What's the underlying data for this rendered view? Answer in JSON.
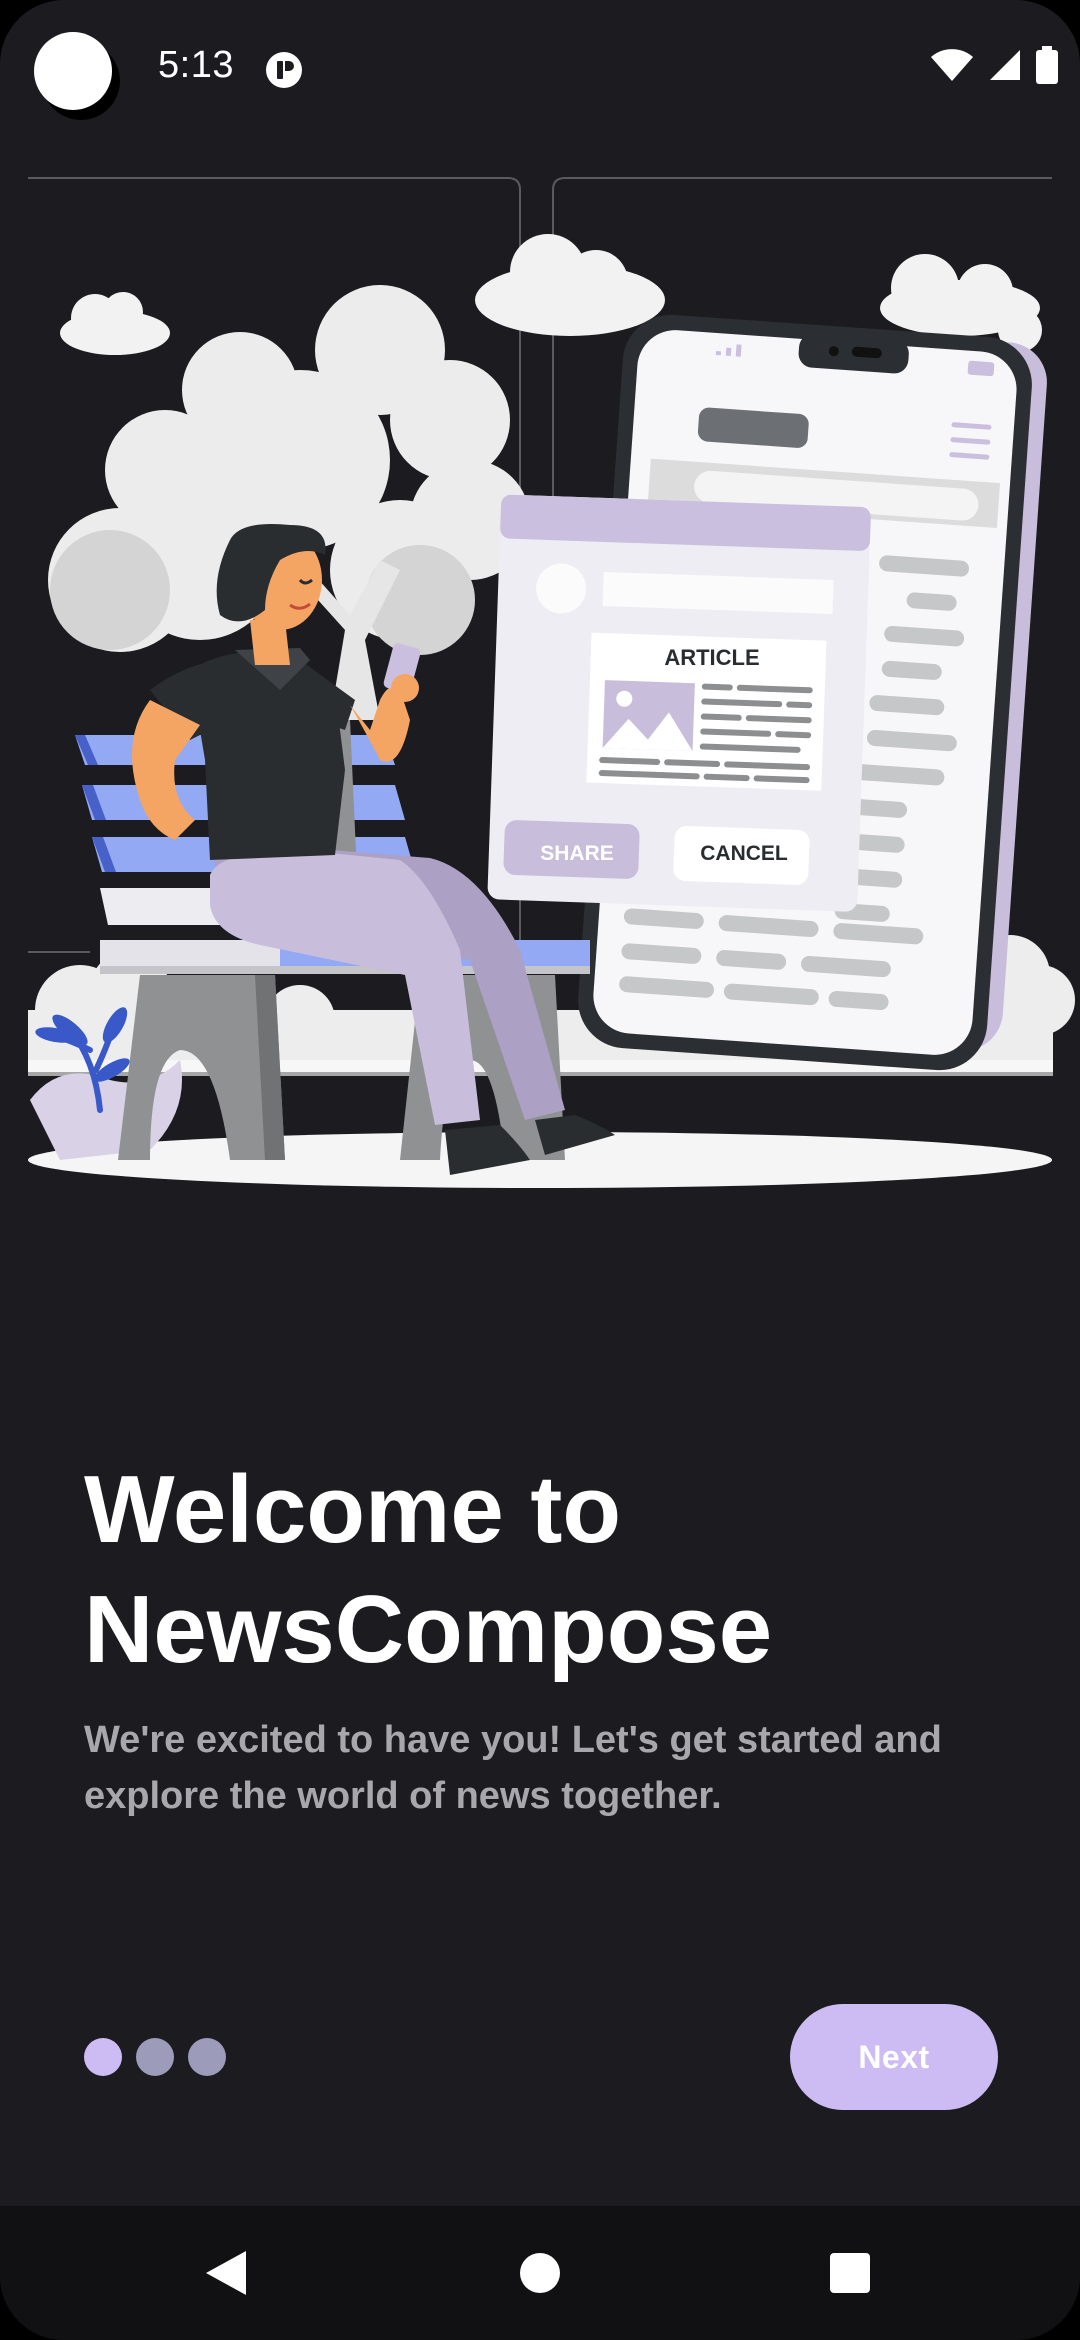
{
  "status_bar": {
    "time": "5:13",
    "icons": [
      "camera-cutout",
      "notification-icon",
      "wifi-icon",
      "cellular-signal-icon",
      "battery-icon"
    ]
  },
  "illustration": {
    "article_card": {
      "heading": "ARTICLE",
      "share_label": "SHARE",
      "cancel_label": "CANCEL"
    }
  },
  "onboarding": {
    "title_line1": "Welcome to",
    "title_line2": "NewsCompose",
    "subtitle_line1": "We're excited to have you! Let's get started and",
    "subtitle_line2": "explore the world of news together.",
    "page_count": 3,
    "current_page": 1,
    "next_label": "Next"
  },
  "nav_bar": {
    "buttons": [
      "back-icon",
      "home-icon",
      "recents-icon"
    ]
  },
  "colors": {
    "background": "#1c1b20",
    "accent": "#cdbcf4",
    "dot_inactive": "#9c9cba",
    "subtitle": "#a8a7ad",
    "bench_blue": "#93a9f4"
  }
}
